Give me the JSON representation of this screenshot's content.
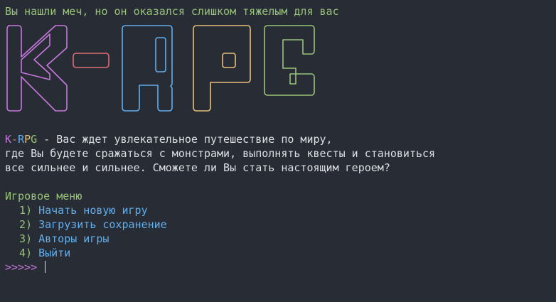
{
  "message": "Вы нашли меч, но он оказался слишком тяжелым для вас",
  "logo": {
    "text": "K-RPG",
    "letters": [
      "K",
      "-",
      "R",
      "P",
      "G"
    ],
    "colors": [
      "#c678dd",
      "#e06c75",
      "#61afef",
      "#e5c07b",
      "#98c379"
    ]
  },
  "intro": {
    "brand_k": "K",
    "brand_dash": "-",
    "brand_r": "R",
    "brand_p": "P",
    "brand_g": "G",
    "line1_rest": " - Вас ждет увлекательное путешествие по миру,",
    "line2": "где Вы будете сражаться с монстрами, выполнять квесты и становиться",
    "line3": "все сильнее и сильнее. Сможете ли Вы стать настоящим героем?"
  },
  "menu": {
    "title": "Игровое меню",
    "items": [
      {
        "number": "1)",
        "label": "Начать новую игру"
      },
      {
        "number": "2)",
        "label": "Загрузить сохранение"
      },
      {
        "number": "3)",
        "label": "Авторы игры"
      },
      {
        "number": "4)",
        "label": "Выйти"
      }
    ]
  },
  "prompt": {
    "symbol": ">>>>>",
    "input_value": ""
  },
  "colors": {
    "background": "#282c34",
    "text": "#dcdfe4",
    "green": "#98c379",
    "blue": "#61afef",
    "purple": "#c678dd",
    "red": "#e06c75",
    "yellow": "#e5c07b"
  }
}
